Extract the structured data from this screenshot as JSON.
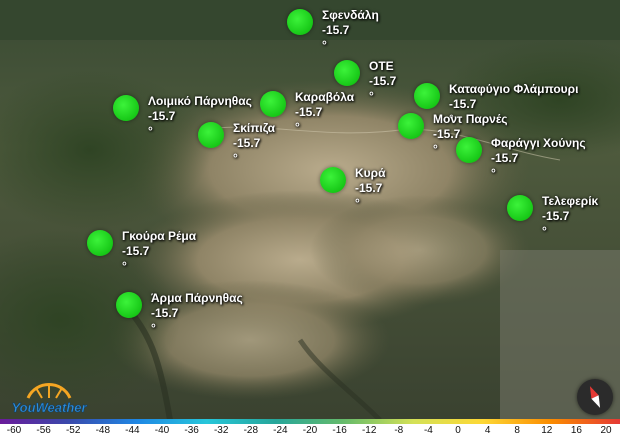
{
  "stations": [
    {
      "name": "Σφενδάλη",
      "temp": "-15.7",
      "unit": "°"
    },
    {
      "name": "ΟΤΕ",
      "temp": "-15.7",
      "unit": "°"
    },
    {
      "name": "Καταφύγιο Φλάμπουρι",
      "temp": "-15.7",
      "unit": "°"
    },
    {
      "name": "Λοιμικό Πάρνηθας",
      "temp": "-15.7",
      "unit": "°"
    },
    {
      "name": "Καραβόλα",
      "temp": "-15.7",
      "unit": "°"
    },
    {
      "name": "Σκίπιζα",
      "temp": "-15.7",
      "unit": "°"
    },
    {
      "name": "Μοντ Παρνές",
      "temp": "-15.7",
      "unit": "°"
    },
    {
      "name": "Φαράγγι Χούνης",
      "temp": "-15.7",
      "unit": "°"
    },
    {
      "name": "Κυρά",
      "temp": "-15.7",
      "unit": "°"
    },
    {
      "name": "Τελεφερίκ",
      "temp": "-15.7",
      "unit": "°"
    },
    {
      "name": "Γκούρα Ρέμα",
      "temp": "-15.7",
      "unit": "°"
    },
    {
      "name": "Άρμα Πάρνηθας",
      "temp": "-15.7",
      "unit": "°"
    }
  ],
  "marker_color": "#22d422",
  "logo": {
    "text": "YouWeather"
  },
  "compass": {
    "icon": "compass-icon"
  },
  "scale": {
    "ticks": [
      "-60",
      "-56",
      "-52",
      "-48",
      "-44",
      "-40",
      "-36",
      "-32",
      "-28",
      "-24",
      "-20",
      "-16",
      "-12",
      "-8",
      "-4",
      "0",
      "4",
      "8",
      "12",
      "16",
      "20"
    ],
    "colors": [
      "#6a1b9a",
      "#3949ab",
      "#1e88e5",
      "#26c6da",
      "#26a69a",
      "#66bb6a",
      "#d4e157",
      "#fdd835",
      "#fb8c00",
      "#e53935"
    ]
  }
}
